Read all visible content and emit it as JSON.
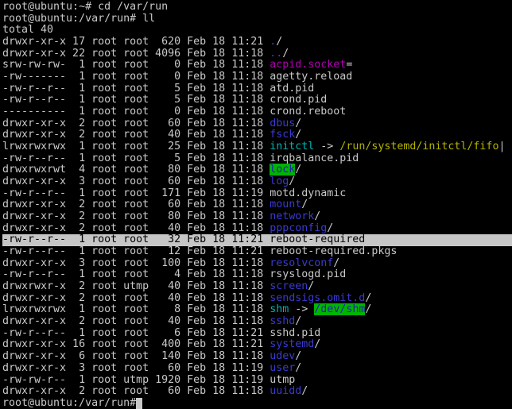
{
  "terminal": {
    "colors": {
      "background": "#000000",
      "foreground": "#c9c9c9",
      "directory": "#3a3ad0",
      "symlink": "#00b2b2",
      "socket": "#b000b0",
      "fifo_target": "#b3b300",
      "sticky_ow_bg": "#00b400",
      "sticky_ow_fg": "#2020b2",
      "selection_bg": "#c6c6c6",
      "selection_fg": "#000000"
    },
    "lines": [
      {
        "kind": "plain",
        "text": "root@ubuntu:~# cd /var/run"
      },
      {
        "kind": "plain",
        "text": "root@ubuntu:/var/run# ll"
      },
      {
        "kind": "plain",
        "text": "total 40"
      },
      {
        "kind": "row",
        "perms": "drwxr-xr-x",
        "links": "17",
        "owner": "root",
        "group": "root",
        "size": "620",
        "date": "Feb 18",
        "time": "11:21",
        "name": [
          [
            ".",
            "dir"
          ],
          [
            "/",
            "fg"
          ]
        ],
        "highlight": false
      },
      {
        "kind": "row",
        "perms": "drwxr-xr-x",
        "links": "22",
        "owner": "root",
        "group": "root",
        "size": "4096",
        "date": "Feb 18",
        "time": "11:18",
        "name": [
          [
            "..",
            "dir"
          ],
          [
            "/",
            "fg"
          ]
        ],
        "highlight": false
      },
      {
        "kind": "row",
        "perms": "srw-rw-rw-",
        "links": "1",
        "owner": "root",
        "group": "root",
        "size": "0",
        "date": "Feb 18",
        "time": "11:18",
        "name": [
          [
            "acpid.socket",
            "sock"
          ],
          [
            "=",
            "fg"
          ]
        ],
        "highlight": false
      },
      {
        "kind": "row",
        "perms": "-rw-------",
        "links": "1",
        "owner": "root",
        "group": "root",
        "size": "0",
        "date": "Feb 18",
        "time": "11:18",
        "name": [
          [
            "agetty.reload",
            "fg"
          ]
        ],
        "highlight": false
      },
      {
        "kind": "row",
        "perms": "-rw-r--r--",
        "links": "1",
        "owner": "root",
        "group": "root",
        "size": "5",
        "date": "Feb 18",
        "time": "11:18",
        "name": [
          [
            "atd.pid",
            "fg"
          ]
        ],
        "highlight": false
      },
      {
        "kind": "row",
        "perms": "-rw-r--r--",
        "links": "1",
        "owner": "root",
        "group": "root",
        "size": "5",
        "date": "Feb 18",
        "time": "11:18",
        "name": [
          [
            "crond.pid",
            "fg"
          ]
        ],
        "highlight": false
      },
      {
        "kind": "row",
        "perms": "----------",
        "links": "1",
        "owner": "root",
        "group": "root",
        "size": "0",
        "date": "Feb 18",
        "time": "11:18",
        "name": [
          [
            "crond.reboot",
            "fg"
          ]
        ],
        "highlight": false
      },
      {
        "kind": "row",
        "perms": "drwxr-xr-x",
        "links": "2",
        "owner": "root",
        "group": "root",
        "size": "60",
        "date": "Feb 18",
        "time": "11:18",
        "name": [
          [
            "dbus",
            "dir"
          ],
          [
            "/",
            "fg"
          ]
        ],
        "highlight": false
      },
      {
        "kind": "row",
        "perms": "drwxr-xr-x",
        "links": "2",
        "owner": "root",
        "group": "root",
        "size": "40",
        "date": "Feb 18",
        "time": "11:18",
        "name": [
          [
            "fsck",
            "dir"
          ],
          [
            "/",
            "fg"
          ]
        ],
        "highlight": false
      },
      {
        "kind": "row",
        "perms": "lrwxrwxrwx",
        "links": "1",
        "owner": "root",
        "group": "root",
        "size": "25",
        "date": "Feb 18",
        "time": "11:18",
        "name": [
          [
            "initctl",
            "link"
          ],
          [
            " -> ",
            "fg"
          ],
          [
            "/run/systemd/initctl/fifo",
            "fifo"
          ],
          [
            "|",
            "fg"
          ]
        ],
        "highlight": false
      },
      {
        "kind": "row",
        "perms": "-rw-r--r--",
        "links": "1",
        "owner": "root",
        "group": "root",
        "size": "5",
        "date": "Feb 18",
        "time": "11:18",
        "name": [
          [
            "irqbalance.pid",
            "fg"
          ]
        ],
        "highlight": false
      },
      {
        "kind": "row",
        "perms": "drwxrwxrwt",
        "links": "4",
        "owner": "root",
        "group": "root",
        "size": "80",
        "date": "Feb 18",
        "time": "11:18",
        "name": [
          [
            "lock",
            "owdir"
          ],
          [
            "/",
            "fg"
          ]
        ],
        "highlight": false
      },
      {
        "kind": "row",
        "perms": "drwxr-xr-x",
        "links": "3",
        "owner": "root",
        "group": "root",
        "size": "60",
        "date": "Feb 18",
        "time": "11:18",
        "name": [
          [
            "log",
            "dir"
          ],
          [
            "/",
            "fg"
          ]
        ],
        "highlight": false
      },
      {
        "kind": "row",
        "perms": "-rw-r--r--",
        "links": "1",
        "owner": "root",
        "group": "root",
        "size": "171",
        "date": "Feb 18",
        "time": "11:19",
        "name": [
          [
            "motd.dynamic",
            "fg"
          ]
        ],
        "highlight": false
      },
      {
        "kind": "row",
        "perms": "drwxr-xr-x",
        "links": "2",
        "owner": "root",
        "group": "root",
        "size": "60",
        "date": "Feb 18",
        "time": "11:18",
        "name": [
          [
            "mount",
            "dir"
          ],
          [
            "/",
            "fg"
          ]
        ],
        "highlight": false
      },
      {
        "kind": "row",
        "perms": "drwxr-xr-x",
        "links": "2",
        "owner": "root",
        "group": "root",
        "size": "80",
        "date": "Feb 18",
        "time": "11:18",
        "name": [
          [
            "network",
            "dir"
          ],
          [
            "/",
            "fg"
          ]
        ],
        "highlight": false
      },
      {
        "kind": "row",
        "perms": "drwxr-xr-x",
        "links": "2",
        "owner": "root",
        "group": "root",
        "size": "40",
        "date": "Feb 18",
        "time": "11:18",
        "name": [
          [
            "pppconfig",
            "dir"
          ],
          [
            "/",
            "fg"
          ]
        ],
        "highlight": false
      },
      {
        "kind": "row",
        "perms": "-rw-r--r--",
        "links": "1",
        "owner": "root",
        "group": "root",
        "size": "32",
        "date": "Feb 18",
        "time": "11:21",
        "name": [
          [
            "reboot-required",
            "fg"
          ]
        ],
        "highlight": true
      },
      {
        "kind": "row",
        "perms": "-rw-r--r--",
        "links": "1",
        "owner": "root",
        "group": "root",
        "size": "12",
        "date": "Feb 18",
        "time": "11:21",
        "name": [
          [
            "reboot-required.pkgs",
            "fg"
          ]
        ],
        "highlight": false
      },
      {
        "kind": "row",
        "perms": "drwxr-xr-x",
        "links": "3",
        "owner": "root",
        "group": "root",
        "size": "100",
        "date": "Feb 18",
        "time": "11:18",
        "name": [
          [
            "resolvconf",
            "dir"
          ],
          [
            "/",
            "fg"
          ]
        ],
        "highlight": false
      },
      {
        "kind": "row",
        "perms": "-rw-r--r--",
        "links": "1",
        "owner": "root",
        "group": "root",
        "size": "4",
        "date": "Feb 18",
        "time": "11:18",
        "name": [
          [
            "rsyslogd.pid",
            "fg"
          ]
        ],
        "highlight": false
      },
      {
        "kind": "row",
        "perms": "drwxrwxr-x",
        "links": "2",
        "owner": "root",
        "group": "utmp",
        "size": "40",
        "date": "Feb 18",
        "time": "11:18",
        "name": [
          [
            "screen",
            "dir"
          ],
          [
            "/",
            "fg"
          ]
        ],
        "highlight": false
      },
      {
        "kind": "row",
        "perms": "drwxr-xr-x",
        "links": "2",
        "owner": "root",
        "group": "root",
        "size": "40",
        "date": "Feb 18",
        "time": "11:18",
        "name": [
          [
            "sendsigs.omit.d",
            "dir"
          ],
          [
            "/",
            "fg"
          ]
        ],
        "highlight": false
      },
      {
        "kind": "row",
        "perms": "lrwxrwxrwx",
        "links": "1",
        "owner": "root",
        "group": "root",
        "size": "8",
        "date": "Feb 18",
        "time": "11:18",
        "name": [
          [
            "shm",
            "link"
          ],
          [
            " -> ",
            "fg"
          ],
          [
            "/dev/shm",
            "owdir"
          ],
          [
            "/",
            "fg"
          ]
        ],
        "highlight": false
      },
      {
        "kind": "row",
        "perms": "drwxr-xr-x",
        "links": "2",
        "owner": "root",
        "group": "root",
        "size": "40",
        "date": "Feb 18",
        "time": "11:18",
        "name": [
          [
            "sshd",
            "dir"
          ],
          [
            "/",
            "fg"
          ]
        ],
        "highlight": false
      },
      {
        "kind": "row",
        "perms": "-rw-r--r--",
        "links": "1",
        "owner": "root",
        "group": "root",
        "size": "6",
        "date": "Feb 18",
        "time": "11:21",
        "name": [
          [
            "sshd.pid",
            "fg"
          ]
        ],
        "highlight": false
      },
      {
        "kind": "row",
        "perms": "drwxr-xr-x",
        "links": "16",
        "owner": "root",
        "group": "root",
        "size": "400",
        "date": "Feb 18",
        "time": "11:21",
        "name": [
          [
            "systemd",
            "dir"
          ],
          [
            "/",
            "fg"
          ]
        ],
        "highlight": false
      },
      {
        "kind": "row",
        "perms": "drwxr-xr-x",
        "links": "6",
        "owner": "root",
        "group": "root",
        "size": "140",
        "date": "Feb 18",
        "time": "11:18",
        "name": [
          [
            "udev",
            "dir"
          ],
          [
            "/",
            "fg"
          ]
        ],
        "highlight": false
      },
      {
        "kind": "row",
        "perms": "drwxr-xr-x",
        "links": "3",
        "owner": "root",
        "group": "root",
        "size": "60",
        "date": "Feb 18",
        "time": "11:19",
        "name": [
          [
            "user",
            "dir"
          ],
          [
            "/",
            "fg"
          ]
        ],
        "highlight": false
      },
      {
        "kind": "row",
        "perms": "-rw-rw-r--",
        "links": "1",
        "owner": "root",
        "group": "utmp",
        "size": "1920",
        "date": "Feb 18",
        "time": "11:19",
        "name": [
          [
            "utmp",
            "fg"
          ]
        ],
        "highlight": false
      },
      {
        "kind": "row",
        "perms": "drwxr-xr-x",
        "links": "2",
        "owner": "root",
        "group": "root",
        "size": "60",
        "date": "Feb 18",
        "time": "11:18",
        "name": [
          [
            "uuidd",
            "dir"
          ],
          [
            "/",
            "fg"
          ]
        ],
        "highlight": false
      },
      {
        "kind": "prompt",
        "text": "root@ubuntu:/var/run#",
        "cursor": true
      }
    ]
  }
}
